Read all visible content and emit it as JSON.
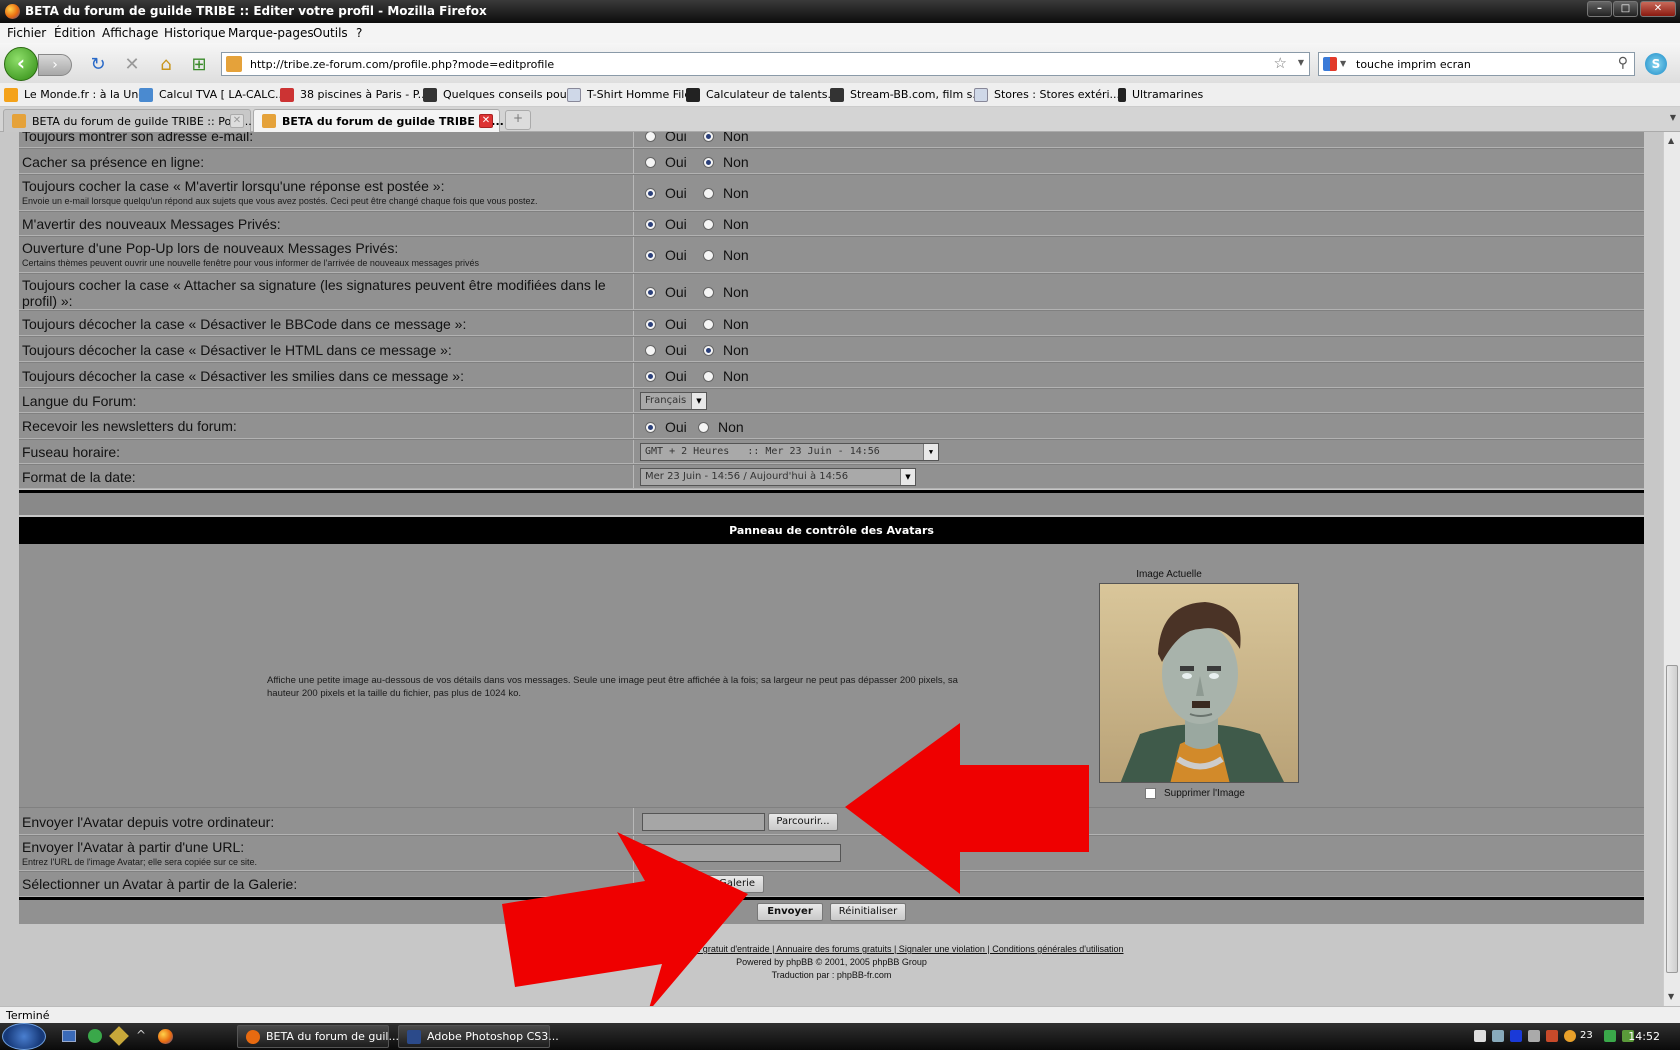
{
  "window": {
    "title": "BETA du forum de guilde TRIBE :: Editer votre profil - Mozilla Firefox"
  },
  "menu": [
    "Fichier",
    "Édition",
    "Affichage",
    "Historique",
    "Marque-pages",
    "Outils",
    "?"
  ],
  "nav": {
    "url": "http://tribe.ze-forum.com/profile.php?mode=editprofile",
    "search": "touche imprim ecran",
    "icons": [
      "back-icon",
      "forward-icon",
      "reload-icon",
      "stop-icon",
      "home-icon",
      "add-tab-icon",
      "star-icon",
      "search-icon"
    ]
  },
  "bookmarks": [
    {
      "label": "Le Monde.fr : à la Une",
      "color": "#f4a21a"
    },
    {
      "label": "Calcul TVA [ LA-CALC...",
      "color": "#4a8ad0"
    },
    {
      "label": "38 piscines à Paris - P...",
      "color": "#c33"
    },
    {
      "label": "Quelques conseils pou...",
      "color": "#333"
    },
    {
      "label": "T-Shirt Homme Filet",
      "color": "#cfd8e8"
    },
    {
      "label": "Calculateur de talents...",
      "color": "#222"
    },
    {
      "label": "Stream-BB.com, film s...",
      "color": "#333"
    },
    {
      "label": "Stores : Stores extéri...",
      "color": "#cfd8e8"
    },
    {
      "label": "Ultramarines",
      "color": "#222"
    }
  ],
  "tabs": [
    {
      "label": "BETA du forum de guilde TRIBE :: Post..."
    },
    {
      "label": "BETA du forum de guilde TRIBE :: ..."
    }
  ],
  "options": {
    "oui": "Oui",
    "non": "Non",
    "rows": [
      {
        "label": "Toujours montrer son adresse e-mail:",
        "hint": "",
        "selected": "non"
      },
      {
        "label": "Cacher sa présence en ligne:",
        "hint": "",
        "selected": "non"
      },
      {
        "label": "Toujours cocher la case « M'avertir lorsqu'une réponse est postée »:",
        "hint": "Envoie un e-mail lorsque quelqu'un répond aux sujets que vous avez postés. Ceci peut être changé chaque fois que vous postez.",
        "selected": "oui"
      },
      {
        "label": "M'avertir des nouveaux Messages Privés:",
        "hint": "",
        "selected": "oui"
      },
      {
        "label": "Ouverture d'une Pop-Up lors de nouveaux Messages Privés:",
        "hint": "Certains thèmes peuvent ouvrir une nouvelle fenêtre pour vous informer de l'arrivée de nouveaux messages privés",
        "selected": "oui"
      },
      {
        "label": "Toujours cocher la case « Attacher sa signature (les signatures peuvent être modifiées dans le profil) »:",
        "hint": "",
        "selected": "oui"
      },
      {
        "label": "Toujours décocher la case « Désactiver le BBCode dans ce message »:",
        "hint": "",
        "selected": "oui"
      },
      {
        "label": "Toujours décocher la case « Désactiver le HTML dans ce message »:",
        "hint": "",
        "selected": "non"
      },
      {
        "label": "Toujours décocher la case « Désactiver les smilies dans ce message »:",
        "hint": "",
        "selected": "oui"
      }
    ],
    "language": {
      "label": "Langue du Forum:",
      "value": "Français"
    },
    "newsletter": {
      "label": "Recevoir les newsletters du forum:",
      "selected": "oui"
    },
    "timezone": {
      "label": "Fuseau horaire:",
      "value": "GMT + 2 Heures   :: Mer 23 Juin - 14:56"
    },
    "dateformat": {
      "label": "Format de la date:",
      "value": "Mer 23 Juin - 14:56 / Aujourd'hui à 14:56"
    }
  },
  "avatar": {
    "header": "Panneau de contrôle des Avatars",
    "description": "Affiche une petite image au-dessous de vos détails dans vos messages. Seule une image peut être affichée à la fois; sa largeur ne peut pas dépasser 200 pixels, sa hauteur 200 pixels et la taille du fichier, pas plus de 1024 ko.",
    "current_label": "Image Actuelle",
    "delete_label": "Supprimer l'Image",
    "upload_label": "Envoyer l'Avatar depuis votre ordinateur:",
    "browse_button": "Parcourir...",
    "url_label": "Envoyer l'Avatar à partir d'une URL:",
    "url_hint": "Entrez l'URL de l'image Avatar; elle sera copiée sur ce site.",
    "gallery_label": "Sélectionner un Avatar à partir de la Galerie:",
    "gallery_button": "la Galerie"
  },
  "form": {
    "submit": "Envoyer",
    "reset": "Réinitialiser"
  },
  "footer": {
    "links": "| Forum gratuit d'entraide | Annuaire des forums gratuits | Signaler une violation | Conditions générales d'utilisation",
    "powered": "Powered by phpBB © 2001, 2005 phpBB Group",
    "translation": "Traduction par : phpBB-fr.com"
  },
  "status": "Terminé",
  "taskbar": {
    "items": [
      {
        "label": "BETA du forum de guil...",
        "color": "#e86a10"
      },
      {
        "label": "Adobe Photoshop CS3...",
        "color": "#2b4a8a"
      }
    ],
    "temp": "23",
    "clock": "14:52"
  },
  "colors": {
    "annotation_arrow": "#ef0000",
    "form_row_bg": "#919191",
    "header_bg": "#000000"
  }
}
